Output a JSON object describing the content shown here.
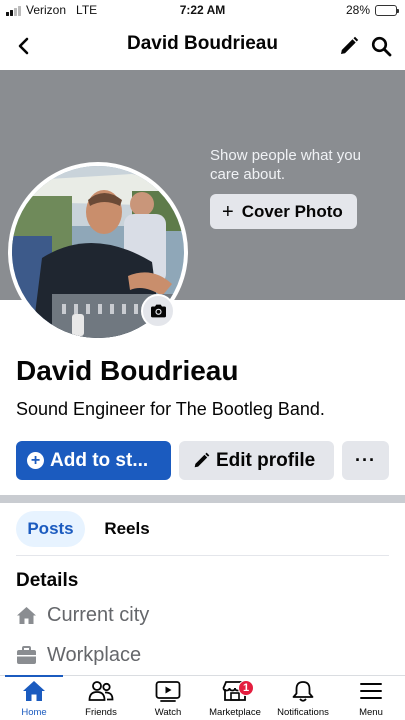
{
  "status_bar": {
    "carrier": "Verizon",
    "network": "LTE",
    "time": "7:22 AM",
    "battery_percent": "28%",
    "battery_level": 0.28
  },
  "header": {
    "title": "David Boudrieau",
    "icons": [
      "back-arrow-icon",
      "pencil-icon",
      "search-icon"
    ]
  },
  "cover": {
    "hint": "Show people what you care about.",
    "button_label": "Cover Photo"
  },
  "profile": {
    "name": "David Boudrieau",
    "bio": "Sound Engineer for The Bootleg Band."
  },
  "actions": {
    "add_label": "Add to st...",
    "edit_label": "Edit profile",
    "more_label": "···"
  },
  "tabs": [
    {
      "label": "Posts",
      "active": true
    },
    {
      "label": "Reels",
      "active": false
    }
  ],
  "details": {
    "title": "Details",
    "items": [
      {
        "icon": "home-icon",
        "label": "Current city"
      },
      {
        "icon": "briefcase-icon",
        "label": "Workplace"
      }
    ]
  },
  "tabbar": {
    "items": [
      {
        "label": "Home",
        "icon": "home-icon",
        "active": true
      },
      {
        "label": "Friends",
        "icon": "friends-icon"
      },
      {
        "label": "Watch",
        "icon": "watch-icon"
      },
      {
        "label": "Marketplace",
        "icon": "marketplace-icon",
        "badge": "1"
      },
      {
        "label": "Notifications",
        "icon": "bell-icon"
      },
      {
        "label": "Menu",
        "icon": "menu-icon"
      }
    ]
  },
  "colors": {
    "accent": "#1b5bbf",
    "cover_bg": "#8a8d91",
    "button_bg": "#e4e6eb",
    "badge": "#e41e3f"
  }
}
